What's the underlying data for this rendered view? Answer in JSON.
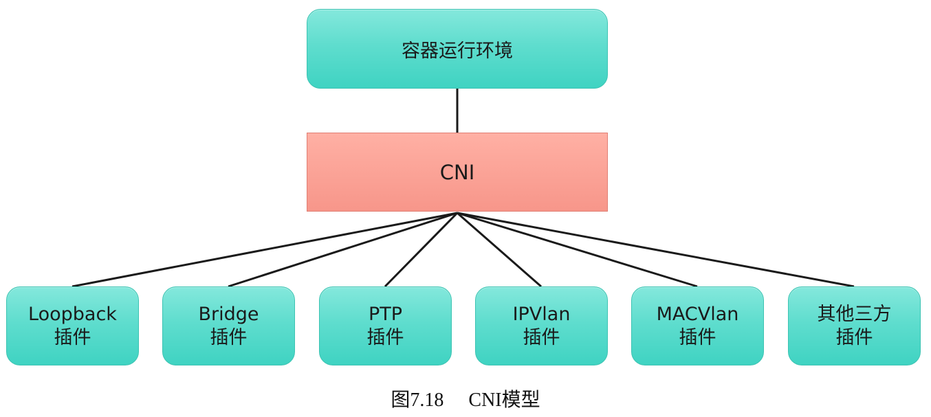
{
  "nodes": {
    "runtime": "容器运行环境",
    "cni": "CNI"
  },
  "plugins": [
    {
      "name": "Loopback",
      "suffix": "插件"
    },
    {
      "name": "Bridge",
      "suffix": "插件"
    },
    {
      "name": "PTP",
      "suffix": "插件"
    },
    {
      "name": "IPVlan",
      "suffix": "插件"
    },
    {
      "name": "MACVlan",
      "suffix": "插件"
    },
    {
      "name": "其他三方",
      "suffix": "插件"
    }
  ],
  "caption": {
    "number": "图7.18",
    "title": "CNI模型"
  },
  "colors": {
    "teal_node": "#5fddce",
    "cni_node": "#f7968a",
    "edge": "#1a1a1a"
  }
}
